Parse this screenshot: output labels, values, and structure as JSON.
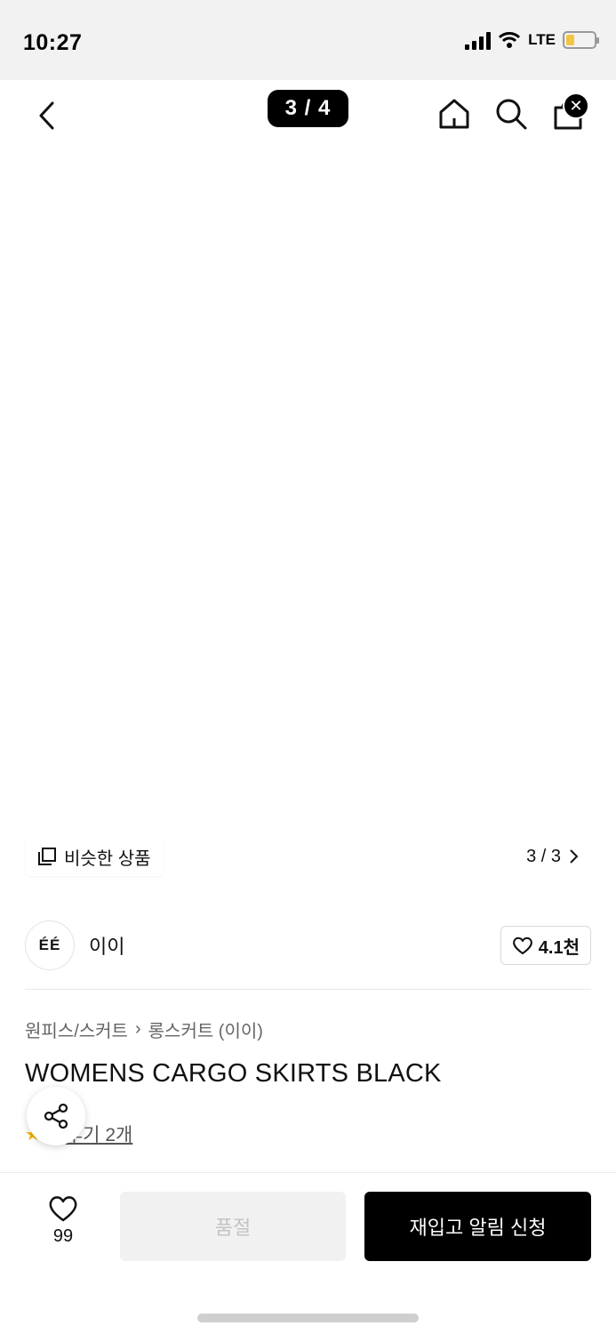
{
  "status_bar": {
    "time": "10:27",
    "network": "LTE",
    "battery_level": 0.3
  },
  "header": {
    "pager": "3 / 4"
  },
  "product_image": {
    "similar_label": "비슷한 상품",
    "counter": "3 / 3"
  },
  "brand": {
    "logo": "ÉÉ",
    "name": "이이",
    "likes": "4.1천"
  },
  "breadcrumb": {
    "category": "원피스/스커트",
    "subcategory": "롱스커트 (이이)"
  },
  "product": {
    "title": "WOMENS CARGO SKIRTS BLACK",
    "review_link": "후기 2개"
  },
  "bottom_bar": {
    "wish_count": "99",
    "sold_out_label": "품절",
    "restock_label": "재입고 알림 신청"
  },
  "colors": {
    "accent": "#000000",
    "sold_out_bg": "#f1f1f1",
    "star": "#f3b400",
    "garment": "#1b2231"
  }
}
